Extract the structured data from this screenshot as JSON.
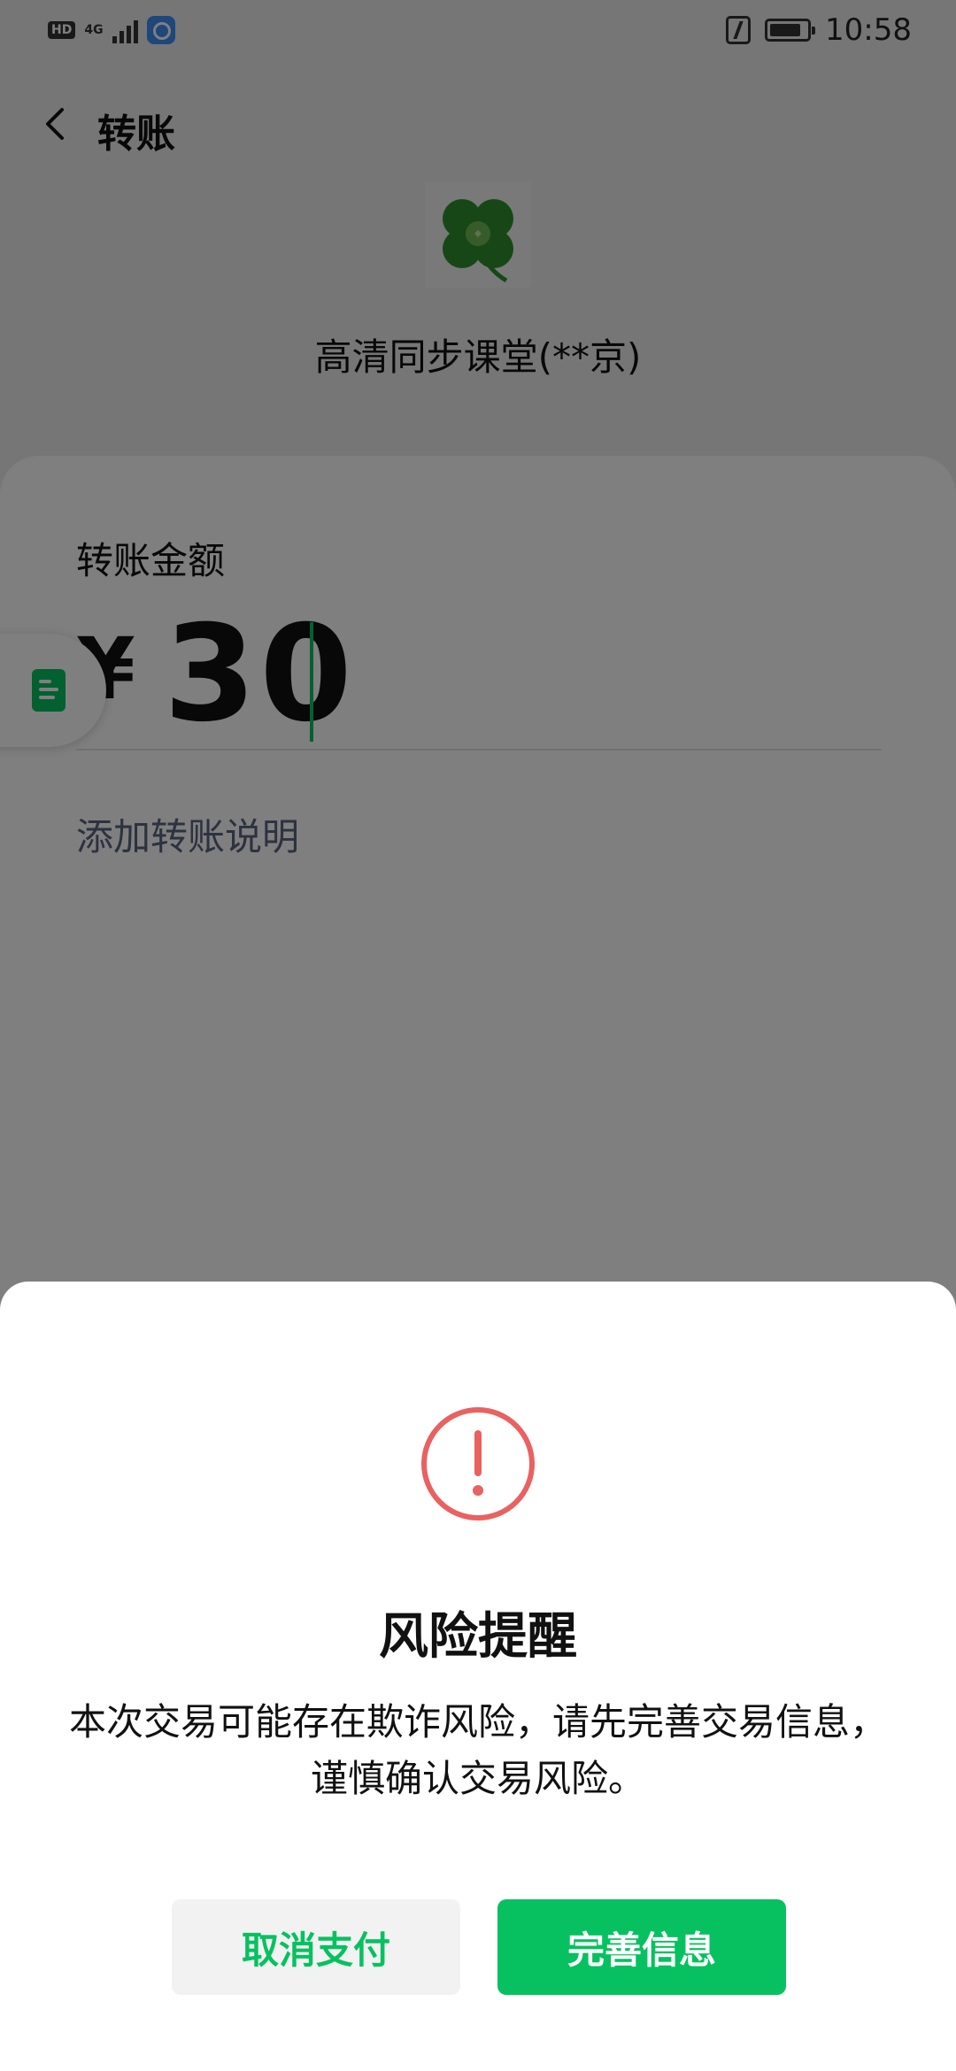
{
  "status_bar": {
    "hd": "HD",
    "network": "4G",
    "time": "10:58"
  },
  "header": {
    "title": "转账"
  },
  "payee": {
    "name": "高清同步课堂(**京)"
  },
  "transfer": {
    "amount_label": "转账金额",
    "currency": "¥",
    "amount": "30",
    "add_note": "添加转账说明"
  },
  "dialog": {
    "title": "风险提醒",
    "message": "本次交易可能存在欺诈风险，请先完善交易信息，谨慎确认交易风险。",
    "cancel_label": "取消支付",
    "confirm_label": "完善信息"
  },
  "colors": {
    "accent": "#07c160",
    "warning": "#e96160",
    "overlay": "rgba(0,0,0,0.5)"
  },
  "icons": {
    "back": "chevron-left-icon",
    "warning": "exclamation-circle-icon",
    "float_tab": "document-icon"
  }
}
